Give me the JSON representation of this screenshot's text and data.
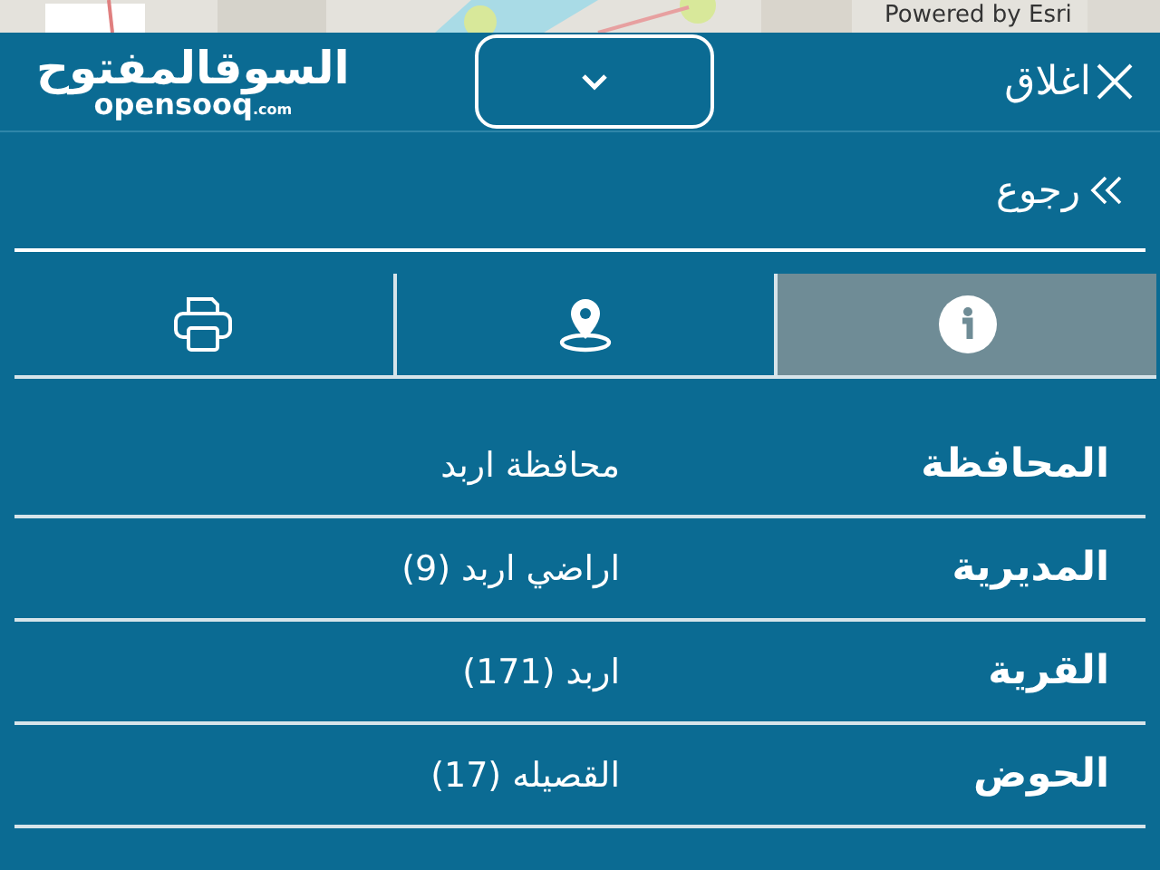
{
  "map_strip": {
    "attribution": "Powered by Esri"
  },
  "header": {
    "close_label": "اغلاق",
    "logo_arabic": "السوقالمفتوح",
    "logo_latin": "opensooq",
    "logo_domain": ".com"
  },
  "back": {
    "label": "رجوع"
  },
  "tabs": [
    {
      "kind": "info",
      "selected": true
    },
    {
      "kind": "location",
      "selected": false
    },
    {
      "kind": "print",
      "selected": false
    }
  ],
  "rows": [
    {
      "label": "المحافظة",
      "value": "محافظة اربد"
    },
    {
      "label": "المديرية",
      "value": "اراضي اربد (9)"
    },
    {
      "label": "القرية",
      "value": "اربد (171)"
    },
    {
      "label": "الحوض",
      "value": "القصيله (17)"
    }
  ]
}
